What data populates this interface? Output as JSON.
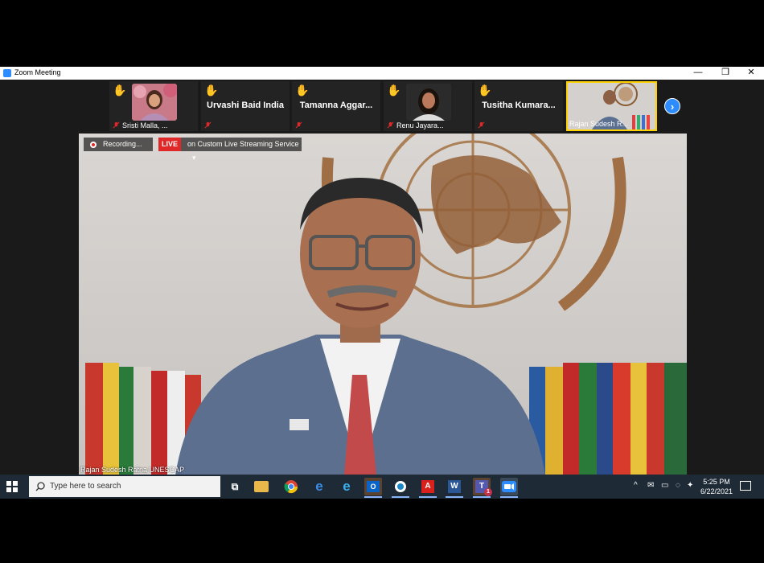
{
  "window": {
    "title": "Zoom Meeting",
    "minimize": "—",
    "restore": "❐",
    "close": "✕"
  },
  "participants": [
    {
      "name": "",
      "label": "Sristi Malla, ...",
      "hand": "✋",
      "has_video": true
    },
    {
      "name": "Urvashi Baid India",
      "label": "",
      "hand": "✋",
      "has_video": false
    },
    {
      "name": "Tamanna  Aggar...",
      "label": "",
      "hand": "✋",
      "has_video": false
    },
    {
      "name": "",
      "label": "Renu Jayara...",
      "hand": "✋",
      "has_video": true
    },
    {
      "name": "Tusitha  Kumara...",
      "label": "",
      "hand": "✋",
      "has_video": false
    },
    {
      "name": "",
      "label": "Rajan Sudesh R...",
      "hand": "",
      "has_video": true
    }
  ],
  "next_page": "›",
  "video": {
    "recording_label": "Recording...",
    "live_label": "LIVE",
    "stream_label": "on Custom Live Streaming Service",
    "stream_caret": "▾",
    "speaker_name": "Rajan Sudesh Ratna UNESCAP"
  },
  "taskbar": {
    "search_placeholder": "Type here to search",
    "apps": [
      "task-view",
      "file-explorer",
      "chrome",
      "edge",
      "internet-explorer",
      "outlook",
      "webex",
      "acrobat",
      "word",
      "teams",
      "zoom"
    ],
    "teams_badge": "1",
    "tray": [
      "^",
      "✉",
      "▭",
      "◌",
      "✦"
    ],
    "time": "5:25 PM",
    "date": "6/22/2021"
  },
  "colors": {
    "zoom_blue": "#2d8cff",
    "live_red": "#e02828",
    "hand_yellow": "#f5c518",
    "taskbar": "#1e2a36"
  }
}
